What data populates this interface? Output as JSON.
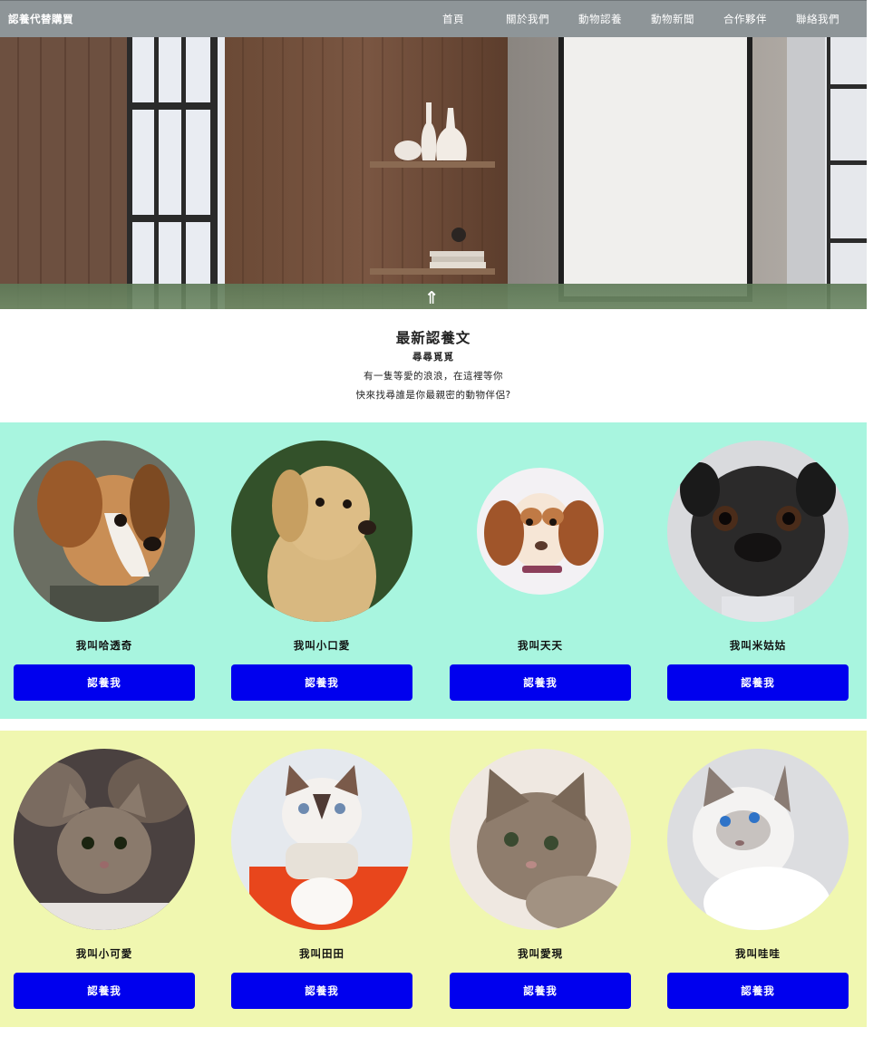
{
  "nav": {
    "brand": "認養代替購買",
    "items": [
      {
        "label": "首頁"
      },
      {
        "label": "關於我們"
      },
      {
        "label": "動物認養"
      },
      {
        "label": "動物新聞"
      },
      {
        "label": "合作夥伴"
      },
      {
        "label": "聯絡我們"
      }
    ]
  },
  "hero": {
    "scroll_top_glyph": "⇑"
  },
  "intro": {
    "title": "最新認養文",
    "subtitle": "尋尋覓覓",
    "line1": "有一隻等愛的浪浪，在這裡等你",
    "line2": "快來找尋誰是你最親密的動物伴侶?"
  },
  "dogs": {
    "background": "#a8f5df",
    "pets": [
      {
        "name": "我叫哈透奇",
        "button": "認養我"
      },
      {
        "name": "我叫小口愛",
        "button": "認養我"
      },
      {
        "name": "我叫天天",
        "button": "認養我"
      },
      {
        "name": "我叫米姑姑",
        "button": "認養我"
      }
    ]
  },
  "cats": {
    "background": "#f0f7b0",
    "pets": [
      {
        "name": "我叫小可愛",
        "button": "認養我"
      },
      {
        "name": "我叫田田",
        "button": "認養我"
      },
      {
        "name": "我叫愛現",
        "button": "認養我"
      },
      {
        "name": "我叫哇哇",
        "button": "認養我"
      }
    ]
  },
  "colors": {
    "nav_bg": "#8e9598",
    "button_bg": "#0000ee"
  }
}
